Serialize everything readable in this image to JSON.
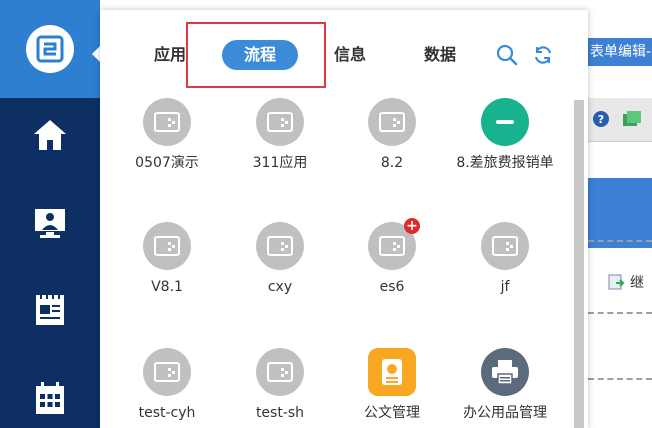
{
  "background": {
    "tab_title": "表单编辑-i",
    "continue_label": "继"
  },
  "panel": {
    "tabs": [
      {
        "label": "应用",
        "active": false
      },
      {
        "label": "流程",
        "active": true
      },
      {
        "label": "信息",
        "active": false
      },
      {
        "label": "数据",
        "active": false
      }
    ],
    "apps": [
      {
        "label": "0507演示",
        "icon": "app-placeholder-icon",
        "style": "gray"
      },
      {
        "label": "311应用",
        "icon": "app-placeholder-icon",
        "style": "gray"
      },
      {
        "label": "8.2",
        "icon": "app-placeholder-icon",
        "style": "gray"
      },
      {
        "label": "8.差旅费报销单",
        "icon": "minus-icon",
        "style": "green"
      },
      {
        "label": "V8.1",
        "icon": "app-placeholder-icon",
        "style": "gray"
      },
      {
        "label": "cxy",
        "icon": "app-placeholder-icon",
        "style": "gray"
      },
      {
        "label": "es6",
        "icon": "app-placeholder-icon",
        "style": "gray",
        "badge": "+"
      },
      {
        "label": "jf",
        "icon": "app-placeholder-icon",
        "style": "gray"
      },
      {
        "label": "test-cyh",
        "icon": "app-placeholder-icon",
        "style": "gray"
      },
      {
        "label": "test-sh",
        "icon": "app-placeholder-icon",
        "style": "gray"
      },
      {
        "label": "公文管理",
        "icon": "document-icon",
        "style": "orange"
      },
      {
        "label": "办公用品管理",
        "icon": "printer-icon",
        "style": "slate"
      }
    ]
  },
  "colors": {
    "rail": "#0d2f63",
    "rail_top": "#2e7fd0",
    "active_tab": "#3b8bd8",
    "highlight": "#e0393e"
  }
}
